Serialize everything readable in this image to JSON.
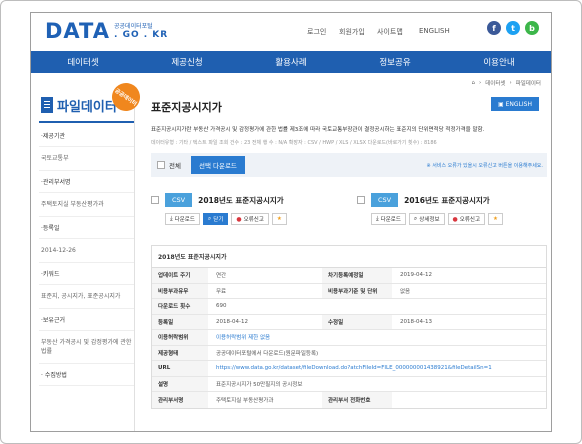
{
  "header": {
    "logo_main": "DATA",
    "logo_kr": "공공데이터포털",
    "logo_domain": ". GO . KR",
    "links": [
      "로그인",
      "회원가입",
      "사이트맵",
      "ENGLISH"
    ],
    "sns": [
      {
        "icon": "facebook-icon",
        "glyph": "f",
        "color": "#3b5998"
      },
      {
        "icon": "twitter-icon",
        "glyph": "t",
        "color": "#1da1f2"
      },
      {
        "icon": "blog-icon",
        "glyph": "b",
        "color": "#3cb64a"
      }
    ]
  },
  "nav": [
    "데이터셋",
    "제공신청",
    "활용사례",
    "정보공유",
    "이용안내"
  ],
  "breadcrumb": [
    "데이터셋",
    "파일데이터"
  ],
  "sidebar": {
    "title": "파일데이터",
    "ribbon": "공공데이터",
    "items": [
      {
        "label": "·제공기관",
        "value": "국토교통부"
      },
      {
        "label": "·관리부서명",
        "value": "주택토지실 부동산평가과"
      },
      {
        "label": "·등록일",
        "value": "2014-12-26"
      },
      {
        "label": "·키워드",
        "value": "표준지, 공시지가, 표준공시지가"
      },
      {
        "label": "·보유근거",
        "value": "부동산 가격공시 및 감정평가에 관한 법률"
      },
      {
        "label": "· 수집방법",
        "value": ""
      }
    ]
  },
  "main": {
    "title": "표준지공시지가",
    "english_button": "ENGLISH",
    "description": "표준지공시지가란 부동산 가격공시 및 감정평가에 관한 법률 제3조에 따라 국토교통부장관이 결정공시하는 표준지의 단위면적당 적정가격을 말함.",
    "meta": "데이터유형 : 기타 / 텍스트   파일 조회 건수 : 23   전체 행 수 : N/A   확장자 : CSV / HWP / XLS / XLSX   다운로드(바로가기 횟수) : 8186",
    "select_all": "전체",
    "select_download": "선택 다운로드",
    "notice": "※ 서비스 오류가 있을시 오류신고 버튼을 이용해주세요."
  },
  "cards": [
    {
      "format": "CSV",
      "name": "2018년도 표준지공시지가",
      "buttons": [
        "다운로드",
        "닫기",
        "오류신고"
      ]
    },
    {
      "format": "CSV",
      "name": "2016년도 표준지공시지가",
      "buttons": [
        "다운로드",
        "상세정보",
        "오류신고"
      ]
    }
  ],
  "detail": {
    "heading": "2018년도 표준지공시지가",
    "rows": [
      {
        "k1": "업데이트 주기",
        "v1": "연간",
        "k2": "차기등록예정일",
        "v2": "2019-04-12"
      },
      {
        "k1": "비용부과유무",
        "v1": "무료",
        "k2": "비용부과기준 및 단위",
        "v2": "없음"
      },
      {
        "k1": "다운로드 횟수",
        "v1": "690"
      },
      {
        "k1": "등록일",
        "v1": "2018-04-12",
        "k2": "수정일",
        "v2": "2018-04-13"
      },
      {
        "k1": "이용허락범위",
        "v1": "이용허락범위 제한 없음"
      },
      {
        "k1": "제공형태",
        "v1": "공공데이터포털에서 다운로드(원문파일등록)"
      },
      {
        "k1": "URL",
        "v1": "https://www.data.go.kr/dataset/fileDownload.do?atchFileId=FILE_000000001438921&fileDetailSn=1"
      },
      {
        "k1": "설명",
        "v1": "표준지공시지가 50만필지의 공시정보"
      },
      {
        "k1": "관리부서명",
        "v1": "주택토지실 부동산평가과",
        "k2": "관리부서 전화번호",
        "v2": ""
      }
    ]
  }
}
